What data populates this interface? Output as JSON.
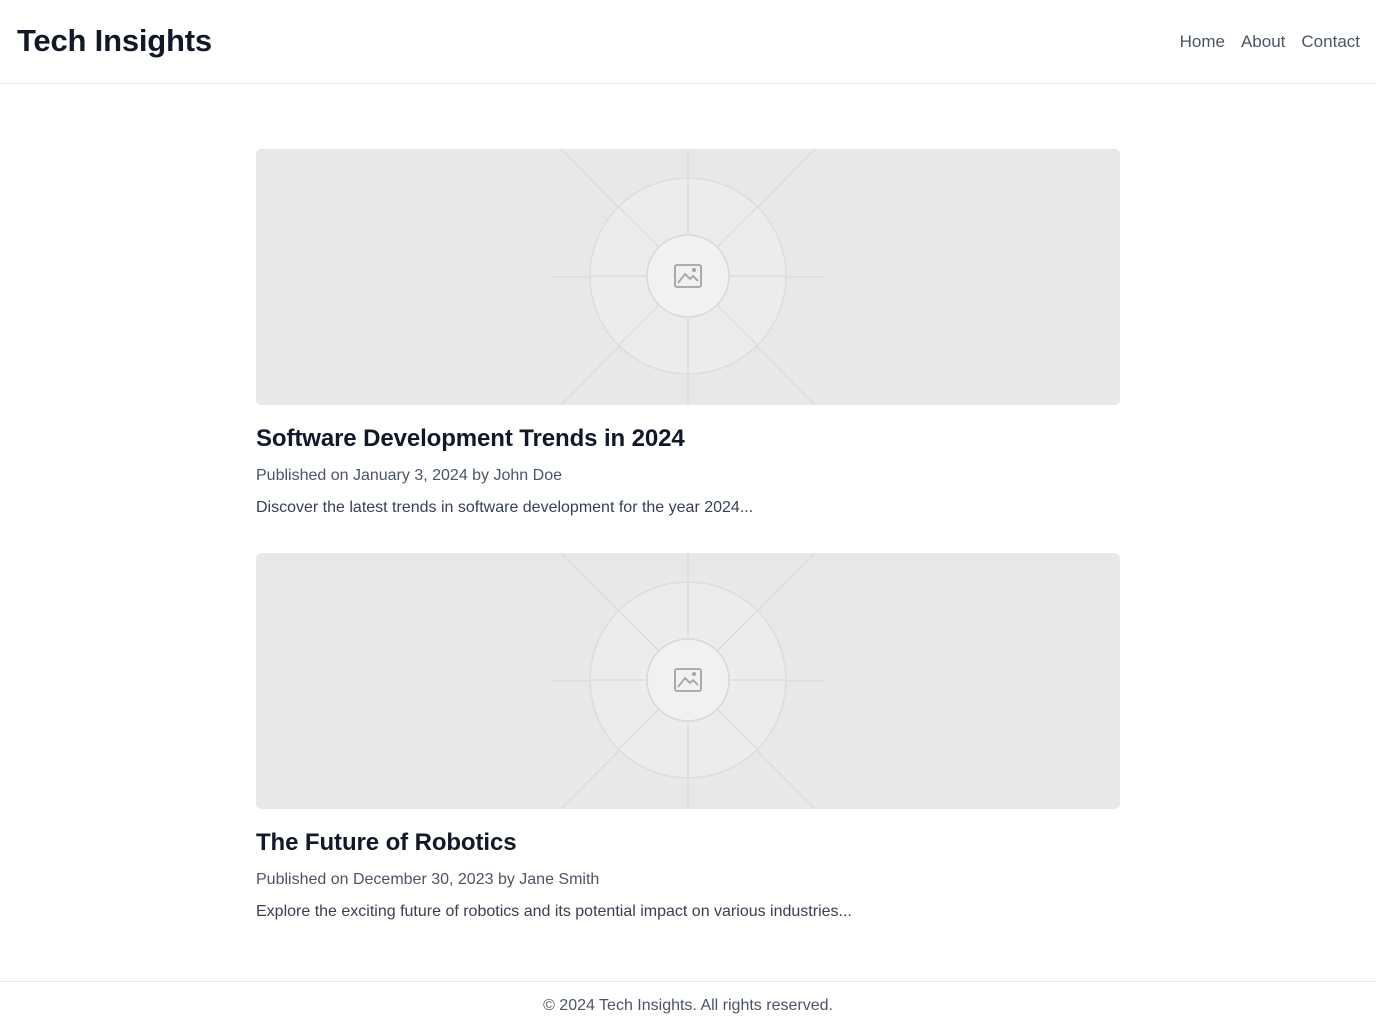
{
  "header": {
    "title": "Tech Insights",
    "nav": [
      {
        "label": "Home"
      },
      {
        "label": "About"
      },
      {
        "label": "Contact"
      }
    ]
  },
  "posts": [
    {
      "title": "Software Development Trends in 2024",
      "meta": "Published on January 3, 2024 by John Doe",
      "excerpt": "Discover the latest trends in software development for the year 2024...",
      "image_icon": "image-placeholder-icon"
    },
    {
      "title": "The Future of Robotics",
      "meta": "Published on December 30, 2023 by Jane Smith",
      "excerpt": "Explore the exciting future of robotics and its potential impact on various industries...",
      "image_icon": "image-placeholder-icon"
    }
  ],
  "footer": {
    "text": "© 2024 Tech Insights. All rights reserved."
  },
  "colors": {
    "text_primary": "#111827",
    "text_secondary": "#4b5563",
    "border": "#e5e7eb",
    "placeholder_bg": "#e8e8e8"
  }
}
